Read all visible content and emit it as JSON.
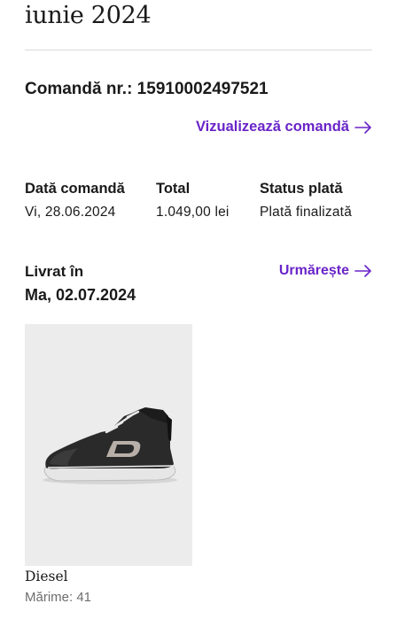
{
  "month_title": "iunie 2024",
  "order": {
    "number_label": "Comandă nr.: 15910002497521",
    "view_link": "Vizualizează comandă"
  },
  "details": {
    "date_label": "Dată comandă",
    "date_value": "Vi, 28.06.2024",
    "total_label": "Total",
    "total_value": "1.049,00 lei",
    "status_label": "Status plată",
    "status_value": "Plată finalizată"
  },
  "delivery": {
    "label": "Livrat în",
    "date": "Ma, 02.07.2024",
    "track_link": "Urmărește"
  },
  "product": {
    "brand": "Diesel",
    "size": "Mărime: 41",
    "image_icon": "high-top-sneaker-image"
  },
  "colors": {
    "accent": "#6a24c8",
    "text": "#1a1a1a",
    "muted": "#6e6e6e",
    "divider": "#d9d9d9",
    "image_bg": "#ececec"
  }
}
